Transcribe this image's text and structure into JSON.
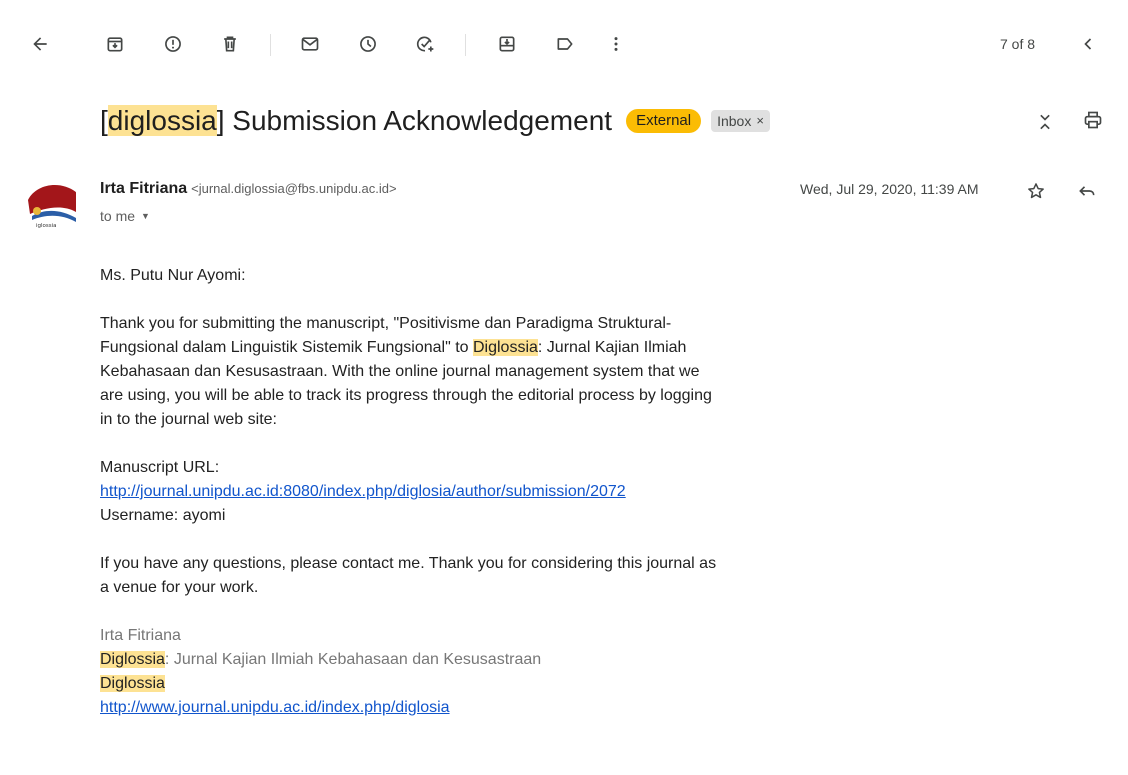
{
  "toolbar": {
    "icons": [
      "back-arrow-icon",
      "archive-icon",
      "report-spam-icon",
      "delete-icon",
      "mark-unread-icon",
      "snooze-icon",
      "add-to-tasks-icon",
      "move-to-icon",
      "label-icon",
      "more-icon"
    ],
    "pager": "7 of 8"
  },
  "subject": {
    "prefix": "[",
    "highlight": "diglossia",
    "rest": "] Submission Acknowledgement",
    "badge_external": "External",
    "badge_inbox": "Inbox",
    "badge_inbox_close": "×"
  },
  "sender": {
    "name": "Irta Fitriana",
    "email": "<jurnal.diglossia@fbs.unipdu.ac.id>",
    "to": "to me",
    "date": "Wed, Jul 29, 2020, 11:39 AM",
    "avatar_text": "iglossia"
  },
  "body": {
    "greeting": "Ms. Putu Nur Ayomi:",
    "para1_a": "Thank you for submitting the manuscript, \"Positivisme dan Paradigma Struktural-Fungsional dalam Linguistik Sistemik Fungsional\" to ",
    "para1_hl": "Diglossia",
    "para1_b": ": Jurnal Kajian Ilmiah Kebahasaan dan Kesusastraan. With the online journal management system that we are using, you will be able to track its progress through the editorial process by logging in to the journal web site:",
    "url_label": "Manuscript URL:",
    "url": "http://journal.unipdu.ac.id:8080/index.php/diglosia/author/submission/2072",
    "username": "Username: ayomi",
    "para2": "If you have any questions, please contact me. Thank you for considering this journal as a venue for your work.",
    "sig_name": "Irta Fitriana",
    "sig_hl1": "Diglossia",
    "sig_journal": ": Jurnal Kajian Ilmiah Kebahasaan dan Kesusastraan",
    "sig_hl2": "Diglossia",
    "sig_url": "http://www.journal.unipdu.ac.id/index.php/diglosia"
  },
  "colors": {
    "highlight": "#fde293",
    "external_badge": "#fbbc04",
    "link": "#1155cc"
  }
}
